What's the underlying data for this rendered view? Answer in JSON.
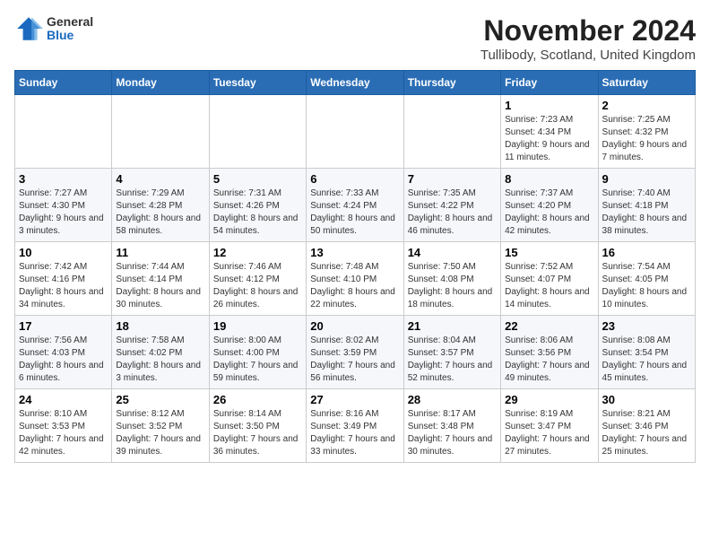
{
  "header": {
    "logo": {
      "general": "General",
      "blue": "Blue"
    },
    "title": "November 2024",
    "location": "Tullibody, Scotland, United Kingdom"
  },
  "days_of_week": [
    "Sunday",
    "Monday",
    "Tuesday",
    "Wednesday",
    "Thursday",
    "Friday",
    "Saturday"
  ],
  "weeks": [
    [
      {
        "day": "",
        "info": ""
      },
      {
        "day": "",
        "info": ""
      },
      {
        "day": "",
        "info": ""
      },
      {
        "day": "",
        "info": ""
      },
      {
        "day": "",
        "info": ""
      },
      {
        "day": "1",
        "info": "Sunrise: 7:23 AM\nSunset: 4:34 PM\nDaylight: 9 hours and 11 minutes."
      },
      {
        "day": "2",
        "info": "Sunrise: 7:25 AM\nSunset: 4:32 PM\nDaylight: 9 hours and 7 minutes."
      }
    ],
    [
      {
        "day": "3",
        "info": "Sunrise: 7:27 AM\nSunset: 4:30 PM\nDaylight: 9 hours and 3 minutes."
      },
      {
        "day": "4",
        "info": "Sunrise: 7:29 AM\nSunset: 4:28 PM\nDaylight: 8 hours and 58 minutes."
      },
      {
        "day": "5",
        "info": "Sunrise: 7:31 AM\nSunset: 4:26 PM\nDaylight: 8 hours and 54 minutes."
      },
      {
        "day": "6",
        "info": "Sunrise: 7:33 AM\nSunset: 4:24 PM\nDaylight: 8 hours and 50 minutes."
      },
      {
        "day": "7",
        "info": "Sunrise: 7:35 AM\nSunset: 4:22 PM\nDaylight: 8 hours and 46 minutes."
      },
      {
        "day": "8",
        "info": "Sunrise: 7:37 AM\nSunset: 4:20 PM\nDaylight: 8 hours and 42 minutes."
      },
      {
        "day": "9",
        "info": "Sunrise: 7:40 AM\nSunset: 4:18 PM\nDaylight: 8 hours and 38 minutes."
      }
    ],
    [
      {
        "day": "10",
        "info": "Sunrise: 7:42 AM\nSunset: 4:16 PM\nDaylight: 8 hours and 34 minutes."
      },
      {
        "day": "11",
        "info": "Sunrise: 7:44 AM\nSunset: 4:14 PM\nDaylight: 8 hours and 30 minutes."
      },
      {
        "day": "12",
        "info": "Sunrise: 7:46 AM\nSunset: 4:12 PM\nDaylight: 8 hours and 26 minutes."
      },
      {
        "day": "13",
        "info": "Sunrise: 7:48 AM\nSunset: 4:10 PM\nDaylight: 8 hours and 22 minutes."
      },
      {
        "day": "14",
        "info": "Sunrise: 7:50 AM\nSunset: 4:08 PM\nDaylight: 8 hours and 18 minutes."
      },
      {
        "day": "15",
        "info": "Sunrise: 7:52 AM\nSunset: 4:07 PM\nDaylight: 8 hours and 14 minutes."
      },
      {
        "day": "16",
        "info": "Sunrise: 7:54 AM\nSunset: 4:05 PM\nDaylight: 8 hours and 10 minutes."
      }
    ],
    [
      {
        "day": "17",
        "info": "Sunrise: 7:56 AM\nSunset: 4:03 PM\nDaylight: 8 hours and 6 minutes."
      },
      {
        "day": "18",
        "info": "Sunrise: 7:58 AM\nSunset: 4:02 PM\nDaylight: 8 hours and 3 minutes."
      },
      {
        "day": "19",
        "info": "Sunrise: 8:00 AM\nSunset: 4:00 PM\nDaylight: 7 hours and 59 minutes."
      },
      {
        "day": "20",
        "info": "Sunrise: 8:02 AM\nSunset: 3:59 PM\nDaylight: 7 hours and 56 minutes."
      },
      {
        "day": "21",
        "info": "Sunrise: 8:04 AM\nSunset: 3:57 PM\nDaylight: 7 hours and 52 minutes."
      },
      {
        "day": "22",
        "info": "Sunrise: 8:06 AM\nSunset: 3:56 PM\nDaylight: 7 hours and 49 minutes."
      },
      {
        "day": "23",
        "info": "Sunrise: 8:08 AM\nSunset: 3:54 PM\nDaylight: 7 hours and 45 minutes."
      }
    ],
    [
      {
        "day": "24",
        "info": "Sunrise: 8:10 AM\nSunset: 3:53 PM\nDaylight: 7 hours and 42 minutes."
      },
      {
        "day": "25",
        "info": "Sunrise: 8:12 AM\nSunset: 3:52 PM\nDaylight: 7 hours and 39 minutes."
      },
      {
        "day": "26",
        "info": "Sunrise: 8:14 AM\nSunset: 3:50 PM\nDaylight: 7 hours and 36 minutes."
      },
      {
        "day": "27",
        "info": "Sunrise: 8:16 AM\nSunset: 3:49 PM\nDaylight: 7 hours and 33 minutes."
      },
      {
        "day": "28",
        "info": "Sunrise: 8:17 AM\nSunset: 3:48 PM\nDaylight: 7 hours and 30 minutes."
      },
      {
        "day": "29",
        "info": "Sunrise: 8:19 AM\nSunset: 3:47 PM\nDaylight: 7 hours and 27 minutes."
      },
      {
        "day": "30",
        "info": "Sunrise: 8:21 AM\nSunset: 3:46 PM\nDaylight: 7 hours and 25 minutes."
      }
    ]
  ]
}
